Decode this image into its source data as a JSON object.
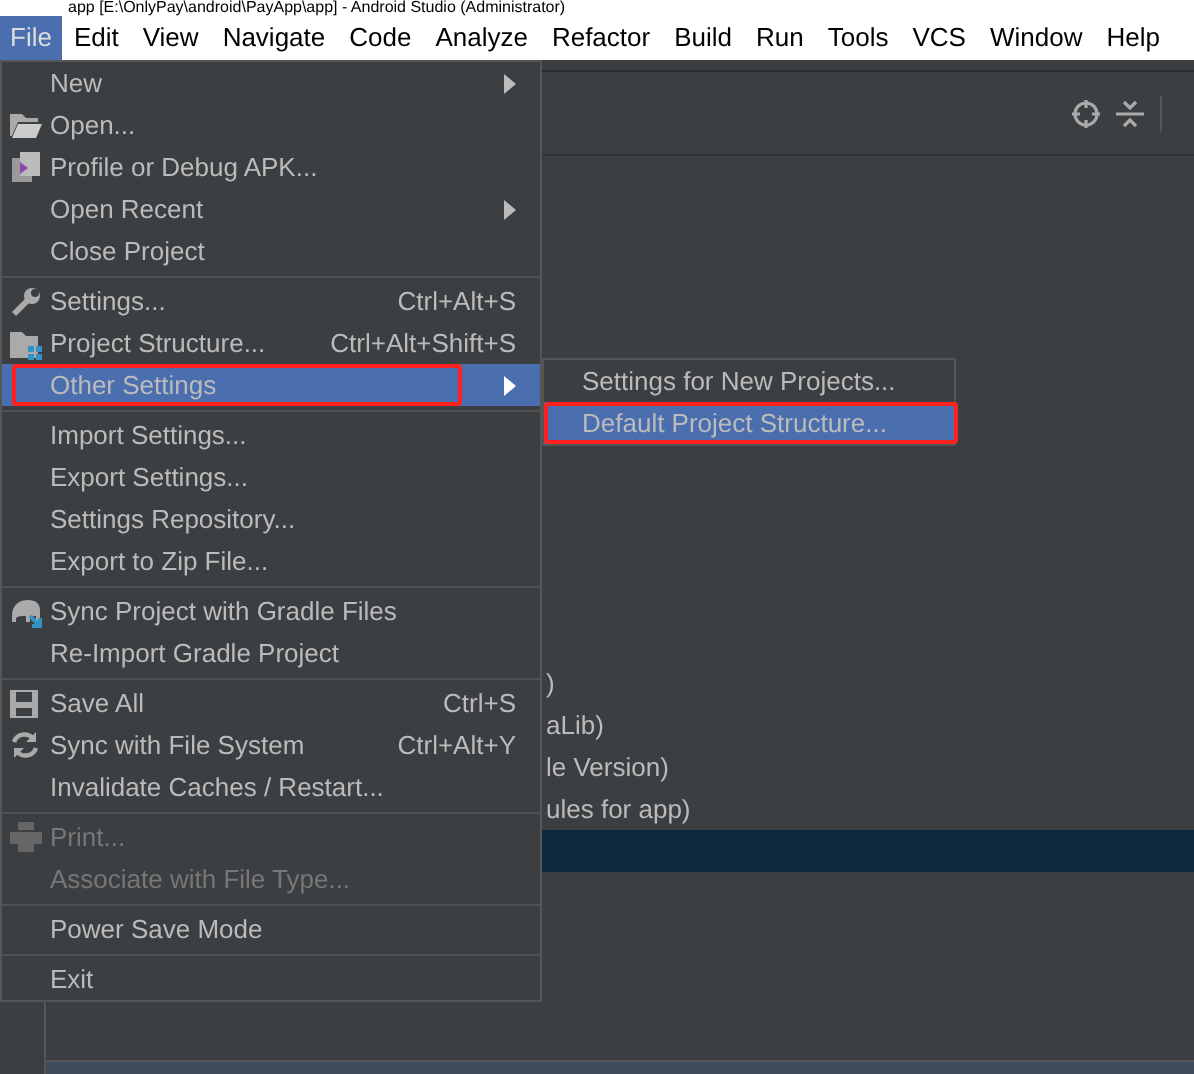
{
  "window": {
    "title": "app [E:\\OnlyPay\\android\\PayApp\\app] - Android Studio (Administrator)"
  },
  "menu_bar": [
    {
      "label": "File",
      "selected": true
    },
    {
      "label": "Edit",
      "selected": false
    },
    {
      "label": "View",
      "selected": false
    },
    {
      "label": "Navigate",
      "selected": false
    },
    {
      "label": "Code",
      "selected": false
    },
    {
      "label": "Analyze",
      "selected": false
    },
    {
      "label": "Refactor",
      "selected": false
    },
    {
      "label": "Build",
      "selected": false
    },
    {
      "label": "Run",
      "selected": false
    },
    {
      "label": "Tools",
      "selected": false
    },
    {
      "label": "VCS",
      "selected": false
    },
    {
      "label": "Window",
      "selected": false
    },
    {
      "label": "Help",
      "selected": false
    }
  ],
  "file_menu": [
    {
      "kind": "item",
      "label": "New",
      "submenu": true,
      "selected": false,
      "disabled": false,
      "highlighted": false
    },
    {
      "kind": "item",
      "label": "Open...",
      "selected": false,
      "disabled": false,
      "highlighted": false
    },
    {
      "kind": "item",
      "label": "Profile or Debug APK...",
      "selected": false,
      "disabled": false,
      "highlighted": false
    },
    {
      "kind": "item",
      "label": "Open Recent",
      "submenu": true,
      "selected": false,
      "disabled": false,
      "highlighted": false
    },
    {
      "kind": "item",
      "label": "Close Project",
      "selected": false,
      "disabled": false,
      "highlighted": false
    },
    {
      "kind": "separator"
    },
    {
      "kind": "item",
      "label": "Settings...",
      "shortcut": "Ctrl+Alt+S",
      "selected": false,
      "disabled": false,
      "highlighted": false
    },
    {
      "kind": "item",
      "label": "Project Structure...",
      "shortcut": "Ctrl+Alt+Shift+S",
      "selected": false,
      "disabled": false,
      "highlighted": false
    },
    {
      "kind": "item",
      "label": "Other Settings",
      "submenu": true,
      "selected": true,
      "disabled": false,
      "highlighted": true
    },
    {
      "kind": "separator"
    },
    {
      "kind": "item",
      "label": "Import Settings...",
      "selected": false,
      "disabled": false,
      "highlighted": false
    },
    {
      "kind": "item",
      "label": "Export Settings...",
      "selected": false,
      "disabled": false,
      "highlighted": false
    },
    {
      "kind": "item",
      "label": "Settings Repository...",
      "selected": false,
      "disabled": false,
      "highlighted": false
    },
    {
      "kind": "item",
      "label": "Export to Zip File...",
      "selected": false,
      "disabled": false,
      "highlighted": false
    },
    {
      "kind": "separator"
    },
    {
      "kind": "item",
      "label": "Sync Project with Gradle Files",
      "selected": false,
      "disabled": false,
      "highlighted": false
    },
    {
      "kind": "item",
      "label": "Re-Import Gradle Project",
      "selected": false,
      "disabled": false,
      "highlighted": false
    },
    {
      "kind": "separator"
    },
    {
      "kind": "item",
      "label": "Save All",
      "shortcut": "Ctrl+S",
      "selected": false,
      "disabled": false,
      "highlighted": false
    },
    {
      "kind": "item",
      "label": "Sync with File System",
      "shortcut": "Ctrl+Alt+Y",
      "selected": false,
      "disabled": false,
      "highlighted": false
    },
    {
      "kind": "item",
      "label": "Invalidate Caches / Restart...",
      "selected": false,
      "disabled": false,
      "highlighted": false
    },
    {
      "kind": "separator"
    },
    {
      "kind": "item",
      "label": "Print...",
      "selected": false,
      "disabled": true,
      "highlighted": false
    },
    {
      "kind": "item",
      "label": "Associate with File Type...",
      "selected": false,
      "disabled": true,
      "highlighted": false
    },
    {
      "kind": "separator"
    },
    {
      "kind": "item",
      "label": "Power Save Mode",
      "selected": false,
      "disabled": false,
      "highlighted": false
    },
    {
      "kind": "separator"
    },
    {
      "kind": "item",
      "label": "Exit",
      "selected": false,
      "disabled": false,
      "highlighted": false
    }
  ],
  "submenu": [
    {
      "label": "Settings for New Projects...",
      "selected": false,
      "highlighted": false
    },
    {
      "label": "Default Project Structure...",
      "selected": true,
      "highlighted": true
    }
  ],
  "project_tree": [
    {
      "label": ")",
      "selected": false
    },
    {
      "label": "aLib)",
      "selected": false
    },
    {
      "label": "le Version)",
      "selected": false
    },
    {
      "label": "ules for app)",
      "selected": false
    },
    {
      "selected": true
    }
  ]
}
